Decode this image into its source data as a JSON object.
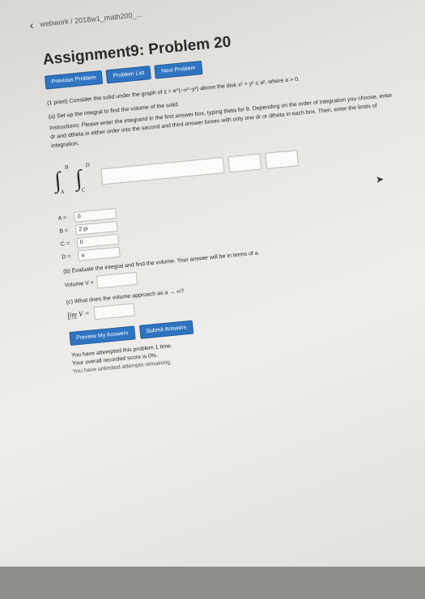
{
  "breadcrumb": "webwork / 2018w1_math200_...",
  "title": "Assignment9: Problem 20",
  "nav": {
    "prev": "Previous Problem",
    "list": "Problem List",
    "next": "Next Problem"
  },
  "problem": {
    "intro": "(1 point) Consider the solid under the graph of z = e^(−x²−y²) above the disk x² + y² ≤ a², where a > 0.",
    "part_a": "(a) Set up the integral to find the volume of the solid.",
    "instructions": "Instructions: Please enter the integrand in the first answer box, typing theta for θ. Depending on the order of integration you choose, enter dr and dtheta in either order into the second and third answer boxes with only one dr or dtheta in each box. Then, enter the limits of integration.",
    "integral_upper_outer": "B",
    "integral_lower_outer": "A",
    "integral_upper_inner": "D",
    "integral_lower_inner": "C"
  },
  "limits": [
    {
      "label": "A =",
      "value": "0"
    },
    {
      "label": "B =",
      "value": "2 pi"
    },
    {
      "label": "C =",
      "value": "0"
    },
    {
      "label": "D =",
      "value": "a"
    }
  ],
  "part_b": {
    "text": "(b) Evaluate the integral and find the volume. Your answer will be in terms of a.",
    "volume_label": "Volume V ="
  },
  "part_c": {
    "text": "(c) What does the volume approach as a → ∞?",
    "lim_text": "lim V =",
    "lim_sub": "a→∞"
  },
  "actions": {
    "preview": "Preview My Answers",
    "submit": "Submit Answers"
  },
  "status": {
    "attempts": "You have attempted this problem 1 time.",
    "score": "Your overall recorded score is 0%.",
    "unlimited": "You have unlimited attempts remaining."
  }
}
